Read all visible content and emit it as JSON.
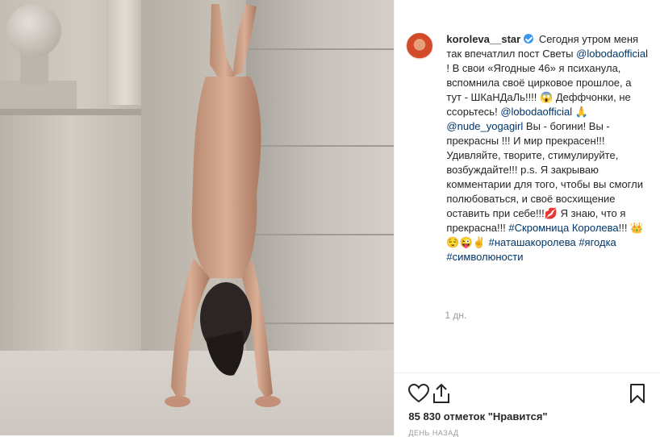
{
  "author": {
    "username": "koroleva__star",
    "verified": true
  },
  "caption": {
    "segments": [
      {
        "type": "text",
        "text": "Сегодня утром меня так впечатлил пост Светы "
      },
      {
        "type": "link",
        "text": "@lobodaofficial"
      },
      {
        "type": "text",
        "text": " ! В свои «Ягодные 46» я психанула, вспомнила своё цирковое прошлое, а тут - ШКаНДаЛь!!!! "
      },
      {
        "type": "emoji",
        "text": "😱"
      },
      {
        "type": "text",
        "text": " Деффчонки, не ссорьтесь! "
      },
      {
        "type": "link",
        "text": "@lobodaofficial"
      },
      {
        "type": "text",
        "text": " "
      },
      {
        "type": "emoji",
        "text": "🙏"
      },
      {
        "type": "text",
        "text": " "
      },
      {
        "type": "link",
        "text": "@nude_yogagirl"
      },
      {
        "type": "text",
        "text": " Вы - богини! Вы - прекрасны !!! И мир прекрасен!!! Удивляйте, творите, стимулируйте, возбуждайте!!! p.s. Я закрываю комментарии для того, чтобы вы смогли полюбоваться, и своё восхищение оставить при себе!!!"
      },
      {
        "type": "emoji",
        "text": "💋"
      },
      {
        "type": "text",
        "text": " Я знаю, что я прекрасна!!! "
      },
      {
        "type": "link",
        "text": "#Скромница Королева"
      },
      {
        "type": "text",
        "text": "!!! "
      },
      {
        "type": "emoji",
        "text": "👑😌😜✌"
      },
      {
        "type": "text",
        "text": " "
      },
      {
        "type": "link",
        "text": "#наташакоролева"
      },
      {
        "type": "text",
        "text": " "
      },
      {
        "type": "link",
        "text": "#ягодка"
      },
      {
        "type": "text",
        "text": " "
      },
      {
        "type": "link",
        "text": "#символюности"
      }
    ]
  },
  "timestamp": "1 дн.",
  "actions": {
    "like_icon": "heart-outline-icon",
    "share_icon": "share-icon",
    "save_icon": "bookmark-icon"
  },
  "likes_text": "85 830 отметок \"Нравится\"",
  "post_age": "ДЕНЬ НАЗАД",
  "colors": {
    "link": "#003569",
    "verified": "#3897f0",
    "muted": "#999999"
  }
}
